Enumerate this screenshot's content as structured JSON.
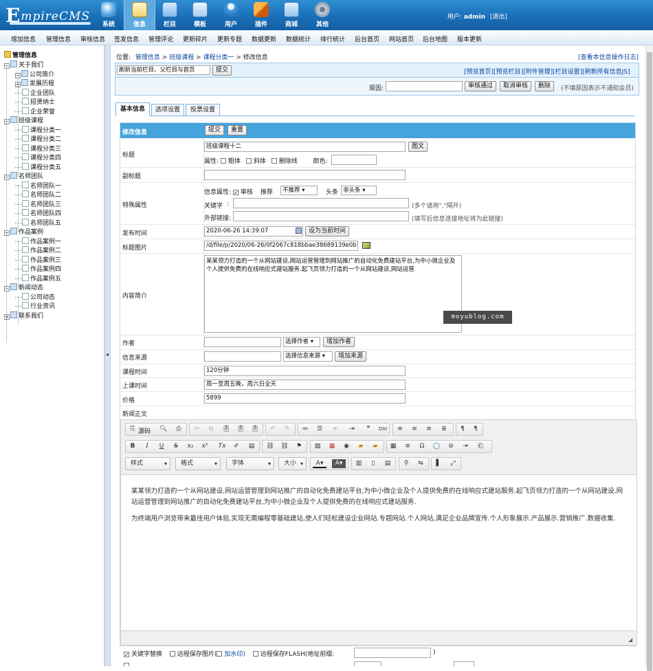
{
  "header": {
    "logo_text_prefix": "E",
    "logo_text_rest": "mpireCMS",
    "nav": [
      {
        "label": "系统",
        "icon": "globe-icon"
      },
      {
        "label": "信息",
        "icon": "document-edit-icon",
        "active": true
      },
      {
        "label": "栏目",
        "icon": "folder-icon"
      },
      {
        "label": "模板",
        "icon": "template-window-icon"
      },
      {
        "label": "用户",
        "icon": "user-icon"
      },
      {
        "label": "插件",
        "icon": "tools-icon"
      },
      {
        "label": "商城",
        "icon": "shop-icon"
      },
      {
        "label": "其他",
        "icon": "gear-icon"
      }
    ],
    "user_label": "用户:",
    "user_name": "admin",
    "logout": "[退出]"
  },
  "submenu": [
    "增加信息",
    "管理信息",
    "审核信息",
    "签发信息",
    "管理评论",
    "更新碎片",
    "更新专题",
    "数据更新",
    "数据统计",
    "排行统计",
    "后台首页",
    "网站首页",
    "后台地图",
    "版本更新"
  ],
  "sidebar": {
    "root": "管理信息",
    "tree": [
      {
        "label": "关于我们",
        "level": 0,
        "type": "minus"
      },
      {
        "label": "公司简介",
        "level": 1,
        "type": "minus"
      },
      {
        "label": "发展历程",
        "level": 1,
        "type": "plus"
      },
      {
        "label": "企业团队",
        "level": 1,
        "type": "page"
      },
      {
        "label": "招贤纳士",
        "level": 1,
        "type": "page"
      },
      {
        "label": "企业荣誉",
        "level": 1,
        "type": "page"
      },
      {
        "label": "班级课程",
        "level": 0,
        "type": "minus"
      },
      {
        "label": "课程分类一",
        "level": 1,
        "type": "page"
      },
      {
        "label": "课程分类二",
        "level": 1,
        "type": "page"
      },
      {
        "label": "课程分类三",
        "level": 1,
        "type": "page"
      },
      {
        "label": "课程分类四",
        "level": 1,
        "type": "page"
      },
      {
        "label": "课程分类五",
        "level": 1,
        "type": "page"
      },
      {
        "label": "名师团队",
        "level": 0,
        "type": "minus"
      },
      {
        "label": "名师团队一",
        "level": 1,
        "type": "page"
      },
      {
        "label": "名师团队二",
        "level": 1,
        "type": "page"
      },
      {
        "label": "名师团队三",
        "level": 1,
        "type": "page"
      },
      {
        "label": "名师团队四",
        "level": 1,
        "type": "page"
      },
      {
        "label": "名师团队五",
        "level": 1,
        "type": "page"
      },
      {
        "label": "作品案例",
        "level": 0,
        "type": "minus"
      },
      {
        "label": "作品案例一",
        "level": 1,
        "type": "page"
      },
      {
        "label": "作品案例二",
        "level": 1,
        "type": "page"
      },
      {
        "label": "作品案例三",
        "level": 1,
        "type": "page"
      },
      {
        "label": "作品案例四",
        "level": 1,
        "type": "page"
      },
      {
        "label": "作品案例五",
        "level": 1,
        "type": "page"
      },
      {
        "label": "新闻动态",
        "level": 0,
        "type": "minus"
      },
      {
        "label": "公司动态",
        "level": 1,
        "type": "page"
      },
      {
        "label": "行业资讯",
        "level": 1,
        "type": "page"
      },
      {
        "label": "联系我们",
        "level": 0,
        "type": "plus"
      }
    ]
  },
  "breadcrumb": {
    "prefix": "位置:",
    "items": [
      "管理信息",
      "班级课程",
      "课程分类一"
    ],
    "current": "修改信息",
    "log_link": "[查看本信息操作日志]"
  },
  "actionbar": {
    "refresh_select": "刷新当前栏目、父栏目与首页",
    "submit": "提交",
    "links": [
      "[预览首页]",
      "[预览栏目]",
      "[附件管理]",
      "[栏目设置]",
      "[刷新所有信息JS]"
    ],
    "reason_label": "原因:",
    "reason_value": "",
    "approve": "审核通过",
    "cancel_approve": "取消审核",
    "delete": "删除",
    "hint": "(不填原因表示不通知会员)"
  },
  "tabs": [
    "基本信息",
    "选项设置",
    "投票设置"
  ],
  "form": {
    "header_title": "修改信息",
    "submit": "提交",
    "reset": "重置",
    "title_label": "标题",
    "title_value": "班级课程十二",
    "title_image_btn": "图文",
    "attr_label": "属性:",
    "bold": "粗体",
    "italic": "斜体",
    "strike": "删除线",
    "color_label": "颜色:",
    "subtitle_label": "副标题",
    "special_label": "特殊属性",
    "info_attr_label": "信息属性:",
    "approve_check": "审核",
    "recommend_label": "推荐",
    "recommend_value": "不推荐",
    "headline_label": "头条",
    "headline_value": "非头条",
    "keywords_label": "关键字",
    "keywords_hint": "(多个请用\",\"隔开)",
    "external_label": "外部链接:",
    "external_hint": "(填写后信息连接地址将为此链接)",
    "pubtime_label": "发布时间",
    "pubtime_value": "2020-06-26 14:39:07",
    "set_now_btn": "设为当前时间",
    "titlepic_label": "标题图片",
    "titlepic_value": "/d/file/p/2020/06-26/0f2067c818bbae38689139e0b77f4",
    "summary_label": "内容简介",
    "summary_value": "某某领力打造的一个从网站建设,网站运营管理到网站推广的自动化免费建站平台,为中小微企业及个人提供免费的在线响应式建站服务.起飞页领力打造的一个从网站建设,网站运营",
    "watermark": "moyublog.com",
    "author_label": "作者",
    "author_select": "选择作者",
    "author_add": "增加作者",
    "source_label": "信息来源",
    "source_select": "选择信息来源",
    "source_add": "增加来源",
    "course_time_label": "课程时间",
    "course_time_value": "120分钟",
    "class_time_label": "上课时间",
    "class_time_value": "周一至周五晚，周六日全天",
    "price_label": "价格",
    "price_value": "5899",
    "body_label": "新闻正文"
  },
  "editor": {
    "source": "源码",
    "style": "样式",
    "format": "格式",
    "font": "字体",
    "size": "大小",
    "para1": "某某领力打造的一个从网站建设,网站运营管理到网站推广的自动化免费建站平台,为中小微企业及个人提供免费的在线响应式建站服务.起飞页领力打造的一个从网站建设,网站运营管理到网站推广的自动化免费建站平台,为中小微企业及个人提供免费的在线响应式建站服务.",
    "para2": "为终端用户浏览带来最佳用户体验,实现无需编程零基础建站,使人们轻松建设企业网站.专题网站.个人网站,满足企业品牌宣传.个人形象展示.产品展示.营销推广.数据收集."
  },
  "footer_opts": {
    "keyword_replace": "关键字替换",
    "remote_save": "远程保存图片(",
    "watermark_link": "加水印)",
    "remote_flash": "远程保存FLASH(地址前缀:",
    "close_paren": ")"
  }
}
